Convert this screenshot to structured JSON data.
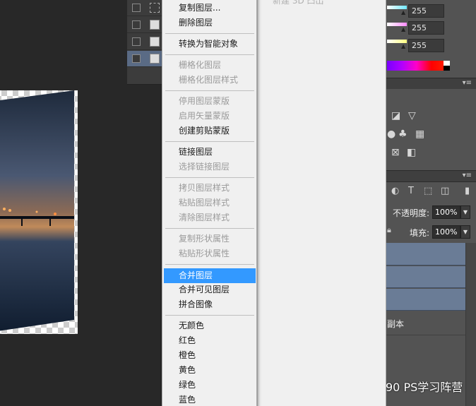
{
  "menu": {
    "items": [
      {
        "label": "复制图层...",
        "enabled": true,
        "highlighted": false
      },
      {
        "label": "删除图层",
        "enabled": true,
        "highlighted": false
      },
      {
        "label": "转换为智能对象",
        "enabled": true,
        "highlighted": false
      },
      {
        "label": "栅格化图层",
        "enabled": false,
        "highlighted": false
      },
      {
        "label": "栅格化图层样式",
        "enabled": false,
        "highlighted": false
      },
      {
        "label": "停用图层蒙版",
        "enabled": false,
        "highlighted": false
      },
      {
        "label": "启用矢量蒙版",
        "enabled": false,
        "highlighted": false
      },
      {
        "label": "创建剪贴蒙版",
        "enabled": true,
        "highlighted": false
      },
      {
        "label": "链接图层",
        "enabled": true,
        "highlighted": false
      },
      {
        "label": "选择链接图层",
        "enabled": false,
        "highlighted": false
      },
      {
        "label": "拷贝图层样式",
        "enabled": false,
        "highlighted": false
      },
      {
        "label": "粘贴图层样式",
        "enabled": false,
        "highlighted": false
      },
      {
        "label": "清除图层样式",
        "enabled": false,
        "highlighted": false
      },
      {
        "label": "复制形状属性",
        "enabled": false,
        "highlighted": false
      },
      {
        "label": "粘贴形状属性",
        "enabled": false,
        "highlighted": false
      },
      {
        "label": "合并图层",
        "enabled": true,
        "highlighted": true
      },
      {
        "label": "合并可见图层",
        "enabled": true,
        "highlighted": false
      },
      {
        "label": "拼合图像",
        "enabled": true,
        "highlighted": false
      },
      {
        "label": "无颜色",
        "enabled": true,
        "highlighted": false
      },
      {
        "label": "红色",
        "enabled": true,
        "highlighted": false
      },
      {
        "label": "橙色",
        "enabled": true,
        "highlighted": false
      },
      {
        "label": "黄色",
        "enabled": true,
        "highlighted": false
      },
      {
        "label": "绿色",
        "enabled": true,
        "highlighted": false
      },
      {
        "label": "蓝色",
        "enabled": true,
        "highlighted": false
      }
    ],
    "ghost_item": "新建 3D 凸出"
  },
  "color_panel": {
    "values": [
      "255",
      "255",
      "255"
    ],
    "colors": [
      "#6fe8ff",
      "#ff8cff",
      "#ffff80"
    ]
  },
  "layers_panel": {
    "opacity_label": "不透明度:",
    "opacity_value": "100%",
    "fill_label": "填充:",
    "fill_value": "100%",
    "layer_partial_name": "副本"
  },
  "watermark": {
    "text": "90 PS学习阵营"
  },
  "accent": "#3399ff"
}
